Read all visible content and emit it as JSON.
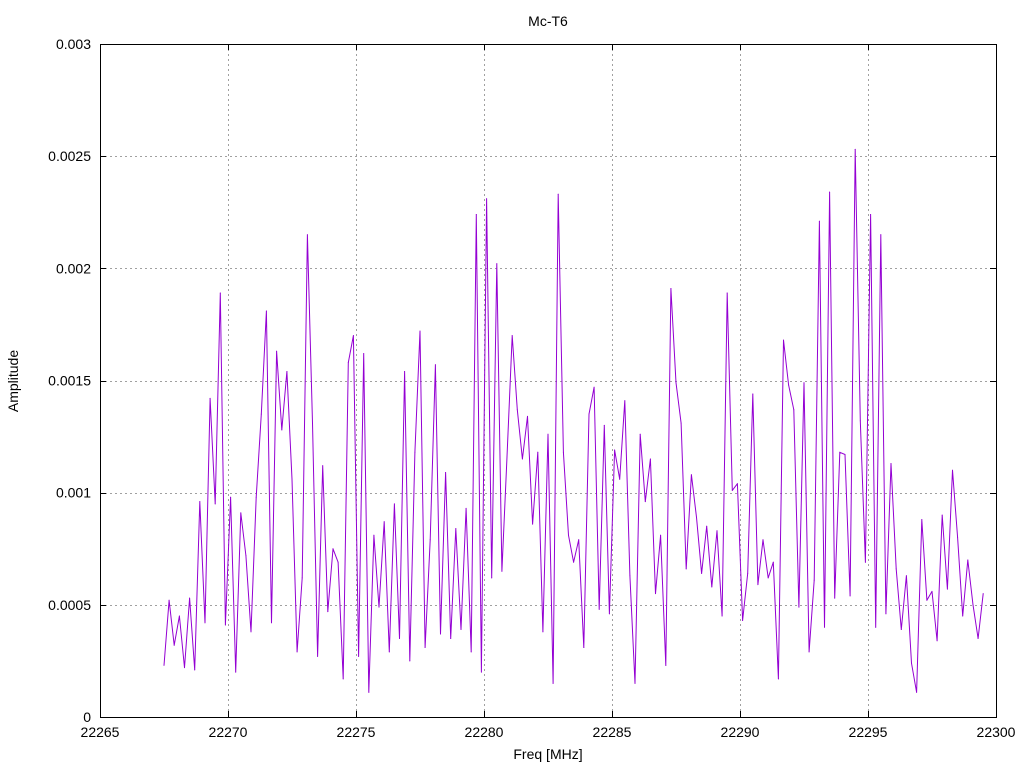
{
  "chart_data": {
    "type": "line",
    "title": "Mc-T6",
    "xlabel": "Freq [MHz]",
    "ylabel": "Amplitude",
    "xlim": [
      22265,
      22300
    ],
    "ylim": [
      0,
      0.003
    ],
    "x_ticks": [
      22265,
      22270,
      22275,
      22280,
      22285,
      22290,
      22295,
      22300
    ],
    "x_tick_labels": [
      "22265",
      "22270",
      "22275",
      "22280",
      "22285",
      "22290",
      "22295",
      "22300"
    ],
    "y_ticks": [
      0,
      0.0005,
      0.001,
      0.0015,
      0.002,
      0.0025,
      0.003
    ],
    "y_tick_labels": [
      "0",
      "0.0005",
      "0.001",
      "0.0015",
      "0.002",
      "0.0025",
      "0.003"
    ],
    "grid": true,
    "legend": "none",
    "series": [
      {
        "color": "#9400d3",
        "x": [
          22267.5,
          22267.7,
          22267.9,
          22268.1,
          22268.3,
          22268.5,
          22268.7,
          22268.9,
          22269.1,
          22269.3,
          22269.5,
          22269.7,
          22269.9,
          22270.1,
          22270.3,
          22270.5,
          22270.7,
          22270.9,
          22271.1,
          22271.3,
          22271.5,
          22271.7,
          22271.9,
          22272.1,
          22272.3,
          22272.5,
          22272.7,
          22272.9,
          22273.1,
          22273.3,
          22273.5,
          22273.7,
          22273.9,
          22274.1,
          22274.3,
          22274.5,
          22274.7,
          22274.9,
          22275.1,
          22275.3,
          22275.5,
          22275.7,
          22275.9,
          22276.1,
          22276.3,
          22276.5,
          22276.7,
          22276.9,
          22277.1,
          22277.3,
          22277.5,
          22277.7,
          22277.9,
          22278.1,
          22278.3,
          22278.5,
          22278.7,
          22278.9,
          22279.1,
          22279.3,
          22279.5,
          22279.7,
          22279.9,
          22280.1,
          22280.3,
          22280.5,
          22280.7,
          22280.9,
          22281.1,
          22281.3,
          22281.5,
          22281.7,
          22281.9,
          22282.1,
          22282.3,
          22282.5,
          22282.7,
          22282.9,
          22283.1,
          22283.3,
          22283.5,
          22283.7,
          22283.9,
          22284.1,
          22284.3,
          22284.5,
          22284.7,
          22284.9,
          22285.1,
          22285.3,
          22285.5,
          22285.7,
          22285.9,
          22286.1,
          22286.3,
          22286.5,
          22286.7,
          22286.9,
          22287.1,
          22287.3,
          22287.5,
          22287.7,
          22287.9,
          22288.1,
          22288.3,
          22288.5,
          22288.7,
          22288.9,
          22289.1,
          22289.3,
          22289.5,
          22289.7,
          22289.9,
          22290.1,
          22290.3,
          22290.5,
          22290.7,
          22290.9,
          22291.1,
          22291.3,
          22291.5,
          22291.7,
          22291.9,
          22292.1,
          22292.3,
          22292.5,
          22292.7,
          22292.9,
          22293.1,
          22293.3,
          22293.5,
          22293.7,
          22293.9,
          22294.1,
          22294.3,
          22294.5,
          22294.7,
          22294.9,
          22295.1,
          22295.3,
          22295.5,
          22295.7,
          22295.9,
          22296.1,
          22296.3,
          22296.5,
          22296.7,
          22296.9,
          22297.1,
          22297.3,
          22297.5,
          22297.7,
          22297.9,
          22298.1,
          22298.3,
          22298.5,
          22298.7,
          22298.9,
          22299.1,
          22299.3,
          22299.5
        ],
        "y": [
          0.00023,
          0.00052,
          0.00032,
          0.00045,
          0.00022,
          0.00053,
          0.00021,
          0.00096,
          0.00042,
          0.00142,
          0.00095,
          0.00189,
          0.00041,
          0.00098,
          0.0002,
          0.00091,
          0.00072,
          0.00038,
          0.00098,
          0.00135,
          0.00181,
          0.00042,
          0.00163,
          0.00128,
          0.00154,
          0.00106,
          0.00029,
          0.00062,
          0.00215,
          0.00131,
          0.00027,
          0.00112,
          0.00047,
          0.00075,
          0.00069,
          0.00017,
          0.00158,
          0.0017,
          0.00027,
          0.00162,
          0.00011,
          0.00081,
          0.00049,
          0.00087,
          0.00029,
          0.00095,
          0.00035,
          0.00154,
          0.00025,
          0.00118,
          0.00172,
          0.00031,
          0.00079,
          0.00157,
          0.00037,
          0.00109,
          0.00035,
          0.00084,
          0.00039,
          0.00093,
          0.00029,
          0.00224,
          0.0002,
          0.00231,
          0.00062,
          0.00202,
          0.00065,
          0.00116,
          0.0017,
          0.00137,
          0.00115,
          0.00134,
          0.00086,
          0.00118,
          0.00038,
          0.00126,
          0.00015,
          0.00233,
          0.00118,
          0.00081,
          0.00069,
          0.00079,
          0.00031,
          0.00135,
          0.00147,
          0.00048,
          0.0013,
          0.00046,
          0.00119,
          0.00106,
          0.00141,
          0.00063,
          0.00015,
          0.00126,
          0.00096,
          0.00115,
          0.00055,
          0.00081,
          0.00023,
          0.00191,
          0.00149,
          0.00131,
          0.00066,
          0.00108,
          0.00089,
          0.00064,
          0.00085,
          0.00058,
          0.00083,
          0.00045,
          0.00189,
          0.00101,
          0.00104,
          0.00043,
          0.00064,
          0.00144,
          0.00059,
          0.00079,
          0.00062,
          0.00069,
          0.00017,
          0.00168,
          0.00148,
          0.00137,
          0.00049,
          0.00149,
          0.00029,
          0.00061,
          0.00221,
          0.0004,
          0.00234,
          0.00053,
          0.00118,
          0.00117,
          0.00054,
          0.00253,
          0.00132,
          0.00069,
          0.00224,
          0.0004,
          0.00215,
          0.00046,
          0.00113,
          0.00066,
          0.00039,
          0.00063,
          0.00024,
          0.00011,
          0.00088,
          0.00052,
          0.00056,
          0.00034,
          0.0009,
          0.00057,
          0.0011,
          0.0008,
          0.00045,
          0.0007,
          0.0005,
          0.00035,
          0.00055
        ]
      }
    ]
  }
}
